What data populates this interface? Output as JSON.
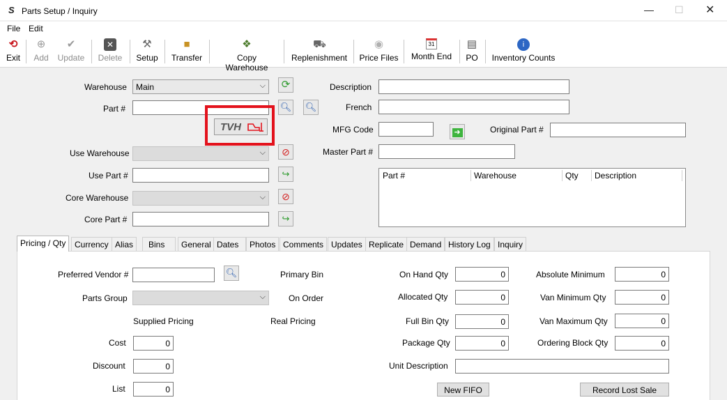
{
  "window": {
    "title": "Parts Setup / Inquiry",
    "app_icon": "S"
  },
  "menu": [
    "File",
    "Edit"
  ],
  "toolbar": {
    "exit": "Exit",
    "add": "Add",
    "update": "Update",
    "delete": "Delete",
    "setup": "Setup",
    "transfer": "Transfer",
    "copy_warehouse": "Copy Warehouse",
    "replenishment": "Replenishment",
    "price_files": "Price Files",
    "month_end": "Month End",
    "po": "PO",
    "inventory_counts": "Inventory Counts",
    "calendar_day": "31"
  },
  "left_form": {
    "warehouse_label": "Warehouse",
    "warehouse_value": "Main",
    "part_label": "Part #",
    "part_value": "",
    "logo_text": "TVH",
    "use_warehouse_label": "Use Warehouse",
    "use_part_label": "Use Part #",
    "core_warehouse_label": "Core Warehouse",
    "core_part_label": "Core Part #"
  },
  "right_form": {
    "description_label": "Description",
    "french_label": "French",
    "mfg_code_label": "MFG Code",
    "original_part_label": "Original Part #",
    "master_part_label": "Master Part #"
  },
  "grid": {
    "columns": [
      "Part #",
      "Warehouse",
      "Qty",
      "Description"
    ]
  },
  "tabs": [
    "Pricing / Qty",
    "Currency",
    "Alias",
    "Bins",
    "General",
    "Dates",
    "Photos",
    "Comments",
    "Updates",
    "Replicate",
    "Demand",
    "History Log",
    "Inquiry"
  ],
  "pricing": {
    "preferred_vendor_label": "Preferred Vendor #",
    "parts_group_label": "Parts Group",
    "supplied_pricing_label": "Supplied Pricing",
    "real_pricing_label": "Real Pricing",
    "primary_bin_label": "Primary Bin",
    "on_order_label": "On Order",
    "cost_label": "Cost",
    "cost_value": "0",
    "discount_label": "Discount",
    "discount_value": "0",
    "list_label": "List",
    "list_value": "0",
    "on_hand_label": "On Hand Qty",
    "on_hand_value": "0",
    "allocated_label": "Allocated Qty",
    "allocated_value": "0",
    "full_bin_label": "Full Bin Qty",
    "full_bin_value": "0",
    "package_label": "Package Qty",
    "package_value": "0",
    "unit_desc_label": "Unit Description",
    "abs_min_label": "Absolute Minimum",
    "abs_min_value": "0",
    "van_min_label": "Van Minimum Qty",
    "van_min_value": "0",
    "van_max_label": "Van Maximum Qty",
    "van_max_value": "0",
    "ordering_block_label": "Ordering Block Qty",
    "ordering_block_value": "0",
    "new_fifo": "New FIFO",
    "record_lost_sale": "Record Lost Sale"
  },
  "colors": {
    "highlight": "#e3121c",
    "refresh_green": "#2e9b2e",
    "stop_red": "#d42020"
  }
}
